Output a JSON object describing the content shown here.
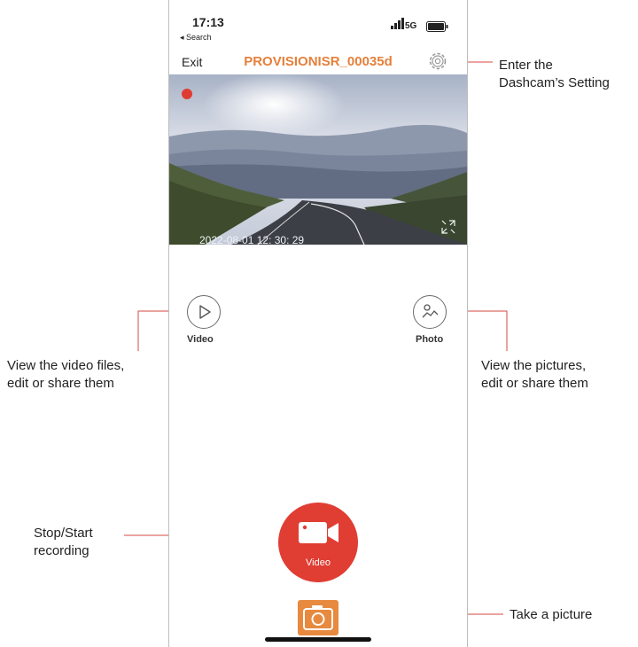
{
  "status_bar": {
    "time": "17:13",
    "back_label": "◂ Search",
    "network": "5G"
  },
  "nav": {
    "exit_label": "Exit",
    "device_name": "PROVISIONISR_00035d"
  },
  "preview": {
    "timestamp": "2022-08-01  12:  30:  29"
  },
  "actions": {
    "video_label": "Video",
    "photo_label": "Photo",
    "record_label": "Video"
  },
  "callouts": {
    "settings_line1": "Enter the",
    "settings_line2": "Dashcam’s Setting",
    "video_line1": "View the video files,",
    "video_line2": "edit or share them",
    "photo_line1": "View the pictures,",
    "photo_line2": "edit or share them",
    "record_line1": "Stop/Start",
    "record_line2": "recording",
    "picture": "Take a picture"
  },
  "colors": {
    "accent_orange": "#e5803b",
    "record_red": "#e03d33",
    "snapshot_orange": "#e78a3f"
  }
}
